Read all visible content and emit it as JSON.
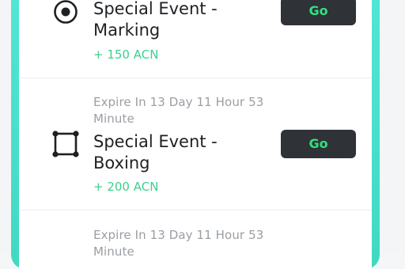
{
  "tasks": [
    {
      "title": "Special Event - Marking",
      "reward": "+ 150 ACN",
      "action": "Go",
      "icon": "radio-target-icon"
    },
    {
      "expire": "Expire In 13 Day 11 Hour 53 Minute",
      "title": "Special Event - Boxing",
      "reward": "+ 200 ACN",
      "action": "Go",
      "icon": "bounding-box-icon"
    },
    {
      "expire": "Expire In 13 Day 11 Hour 53 Minute"
    }
  ],
  "colors": {
    "accent_border": "#4fe3d0",
    "reward_green": "#3ecf8e",
    "button_bg": "#2f3236",
    "button_text": "#2ee17f"
  }
}
